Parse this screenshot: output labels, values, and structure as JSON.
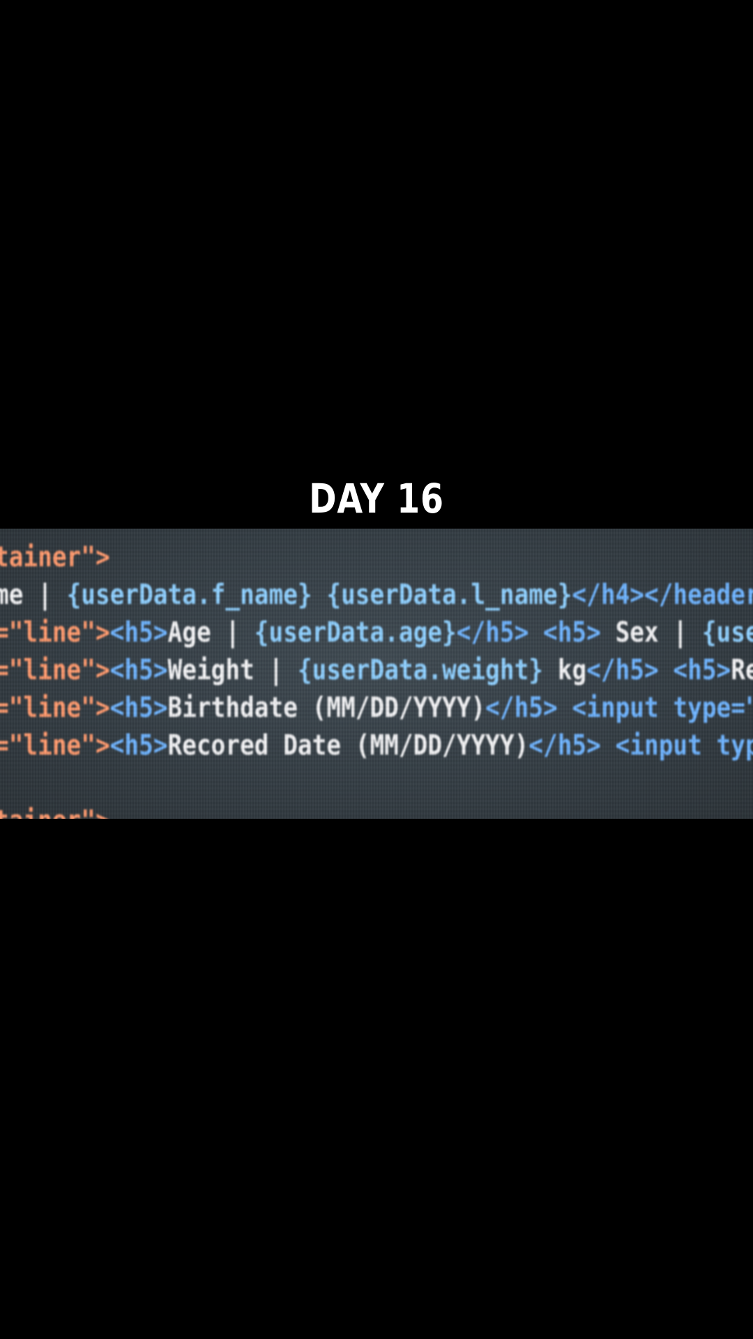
{
  "caption": "DAY 16",
  "code": {
    "lines": [
      [
        {
          "t": "tainer\">",
          "c": "str"
        }
      ],
      [
        {
          "t": "me | ",
          "c": "txt"
        },
        {
          "t": "{userData.f_name} {userData.l_name}",
          "c": "var"
        },
        {
          "t": "</h4></header",
          "c": "tag"
        }
      ],
      [
        {
          "t": "=\"line\">",
          "c": "str"
        },
        {
          "t": "<h5>",
          "c": "tag"
        },
        {
          "t": "Age | ",
          "c": "txt"
        },
        {
          "t": "{userData.age}",
          "c": "var"
        },
        {
          "t": "</h5> <h5>",
          "c": "tag"
        },
        {
          "t": " Sex | ",
          "c": "txt"
        },
        {
          "t": "{use",
          "c": "var"
        }
      ],
      [
        {
          "t": "=\"line\">",
          "c": "str"
        },
        {
          "t": "<h5>",
          "c": "tag"
        },
        {
          "t": "Weight | ",
          "c": "txt"
        },
        {
          "t": "{userData.weight}",
          "c": "var"
        },
        {
          "t": " kg",
          "c": "txt"
        },
        {
          "t": "</h5> <h5>",
          "c": "tag"
        },
        {
          "t": "Re",
          "c": "txt"
        }
      ],
      [
        {
          "t": "=\"line\">",
          "c": "str"
        },
        {
          "t": "<h5>",
          "c": "tag"
        },
        {
          "t": "Birthdate (MM/DD/YYYY)",
          "c": "txt"
        },
        {
          "t": "</h5>",
          "c": "tag"
        },
        {
          "t": " <input type=\"",
          "c": "tag"
        }
      ],
      [
        {
          "t": "=\"line\">",
          "c": "str"
        },
        {
          "t": "<h5>",
          "c": "tag"
        },
        {
          "t": "Recored Date (MM/DD/YYYY)",
          "c": "txt"
        },
        {
          "t": "</h5>",
          "c": "tag"
        },
        {
          "t": " <input typ",
          "c": "tag"
        }
      ],
      [],
      [
        {
          "t": "tainer\">",
          "c": "str"
        }
      ]
    ]
  },
  "colors": {
    "background": "#000000",
    "caption": "#ffffff",
    "string": "#ff9a6e",
    "tag": "#6fb4ff",
    "text": "#f3f3f5",
    "variable": "#8fd0ff"
  }
}
